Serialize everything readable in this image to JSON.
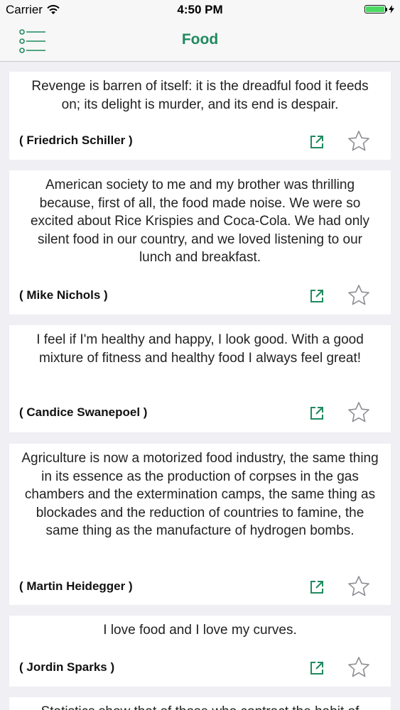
{
  "status_bar": {
    "carrier": "Carrier",
    "time": "4:50 PM"
  },
  "nav": {
    "title": "Food",
    "menu_icon": "list-menu-icon"
  },
  "colors": {
    "accent": "#1f8a5e",
    "battery": "#4cd964"
  },
  "quotes": [
    {
      "text": "Revenge is barren of itself: it is the dreadful food it feeds on; its delight is murder, and its end is despair.",
      "author": "( Friedrich Schiller )"
    },
    {
      "text": "American society to me and my brother was thrilling because, first of all, the food made noise. We were so excited about Rice Krispies and Coca-Cola. We had only silent food in our country, and we loved listening to our lunch and breakfast.",
      "author": "( Mike Nichols )"
    },
    {
      "text": "I feel if I'm healthy and happy, I look good. With a good mixture of fitness and healthy food I always feel great!",
      "author": "( Candice Swanepoel )"
    },
    {
      "text": "Agriculture is now a motorized food industry, the same thing in its essence as the production of corpses in the gas chambers and the extermination camps, the same thing as blockades and the reduction of countries to famine, the same thing as the manufacture of hydrogen bombs.",
      "author": "( Martin Heidegger )"
    },
    {
      "text": "I love food and I love my curves.",
      "author": "( Jordin Sparks )"
    },
    {
      "text": "Statistics show that of those who contract the habit of",
      "author": ""
    }
  ]
}
